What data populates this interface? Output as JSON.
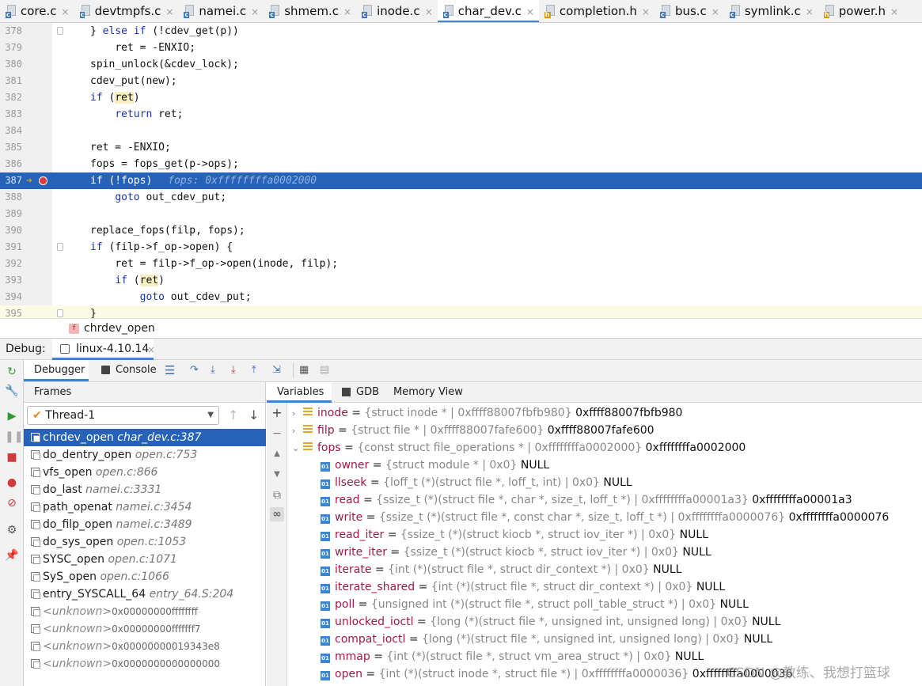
{
  "tabs": [
    {
      "label": "core.c",
      "type": "c"
    },
    {
      "label": "devtmpfs.c",
      "type": "c"
    },
    {
      "label": "namei.c",
      "type": "c"
    },
    {
      "label": "shmem.c",
      "type": "c"
    },
    {
      "label": "inode.c",
      "type": "c"
    },
    {
      "label": "char_dev.c",
      "type": "c",
      "active": true
    },
    {
      "label": "completion.h",
      "type": "h"
    },
    {
      "label": "bus.c",
      "type": "c"
    },
    {
      "label": "symlink.c",
      "type": "c"
    },
    {
      "label": "power.h",
      "type": "h"
    }
  ],
  "editor": {
    "lines": [
      {
        "n": "378",
        "text": "} else if (!cdev_get(p))"
      },
      {
        "n": "379",
        "text": "    ret = -ENXIO;"
      },
      {
        "n": "380",
        "text": "spin_unlock(&cdev_lock);"
      },
      {
        "n": "381",
        "text": "cdev_put(new);"
      },
      {
        "n": "382",
        "text": "if (ret)"
      },
      {
        "n": "383",
        "text": "    return ret;"
      },
      {
        "n": "384",
        "text": ""
      },
      {
        "n": "385",
        "text": "ret = -ENXIO;"
      },
      {
        "n": "386",
        "text": "fops = fops_get(p->ops);"
      },
      {
        "n": "387",
        "text": "if (!fops)",
        "inline": "fops: 0xffffffffa0002000"
      },
      {
        "n": "388",
        "text": "    goto out_cdev_put;"
      },
      {
        "n": "389",
        "text": ""
      },
      {
        "n": "390",
        "text": "replace_fops(filp, fops);"
      },
      {
        "n": "391",
        "text": "if (filp->f_op->open) {"
      },
      {
        "n": "392",
        "text": "    ret = filp->f_op->open(inode, filp);"
      },
      {
        "n": "393",
        "text": "    if (ret)"
      },
      {
        "n": "394",
        "text": "        goto out_cdev_put;"
      },
      {
        "n": "395",
        "text": "}"
      }
    ]
  },
  "breadcrumb": {
    "badge": "f",
    "label": "chrdev_open"
  },
  "debug": {
    "title": "Debug:",
    "session": "linux-4.10.14",
    "tabs": {
      "debugger": "Debugger",
      "console": "Console"
    },
    "frames_label": "Frames",
    "thread": "Thread-1",
    "frames": [
      {
        "fn": "chrdev_open",
        "loc": "char_dev.c:387"
      },
      {
        "fn": "do_dentry_open",
        "loc": "open.c:753"
      },
      {
        "fn": "vfs_open",
        "loc": "open.c:866"
      },
      {
        "fn": "do_last",
        "loc": "namei.c:3331"
      },
      {
        "fn": "path_openat",
        "loc": "namei.c:3454"
      },
      {
        "fn": "do_filp_open",
        "loc": "namei.c:3489"
      },
      {
        "fn": "do_sys_open",
        "loc": "open.c:1053"
      },
      {
        "fn": "SYSC_open",
        "loc": "open.c:1071"
      },
      {
        "fn": "SyS_open",
        "loc": "open.c:1066"
      },
      {
        "fn": "entry_SYSCALL_64",
        "loc": "entry_64.S:204"
      },
      {
        "unknown": "<unknown>",
        "addr": "0x00000000ffffffff"
      },
      {
        "unknown": "<unknown>",
        "addr": "0x00000000fffffff7"
      },
      {
        "unknown": "<unknown>",
        "addr": "0x00000000019343e8"
      },
      {
        "unknown": "<unknown>",
        "addr": "0x0000000000000000"
      }
    ],
    "var_tabs": {
      "variables": "Variables",
      "gdb": "GDB",
      "memory": "Memory View"
    },
    "variables": [
      {
        "name": "inode",
        "type": "{struct inode * | 0xffff88007fbfb980}",
        "value": "0xffff88007fbfb980",
        "kind": "stack",
        "arrow": "›"
      },
      {
        "name": "filp",
        "type": "{struct file * | 0xffff88007fafe600}",
        "value": "0xffff88007fafe600",
        "kind": "stack",
        "arrow": "›"
      },
      {
        "name": "fops",
        "type": "{const struct file_operations * | 0xffffffffa0002000}",
        "value": "0xffffffffa0002000",
        "kind": "stack",
        "arrow": "⌄"
      },
      {
        "name": "owner",
        "type": "{struct module * | 0x0}",
        "value": "NULL",
        "kind": "field"
      },
      {
        "name": "llseek",
        "type": "{loff_t (*)(struct file *, loff_t, int) | 0x0}",
        "value": "NULL",
        "kind": "field"
      },
      {
        "name": "read",
        "type": "{ssize_t (*)(struct file *, char *, size_t, loff_t *) | 0xffffffffa00001a3}",
        "value": "0xffffffffa00001a3",
        "kind": "field"
      },
      {
        "name": "write",
        "type": "{ssize_t (*)(struct file *, const char *, size_t, loff_t *) | 0xffffffffa0000076}",
        "value": "0xffffffffa0000076",
        "kind": "field"
      },
      {
        "name": "read_iter",
        "type": "{ssize_t (*)(struct kiocb *, struct iov_iter *) | 0x0}",
        "value": "NULL",
        "kind": "field"
      },
      {
        "name": "write_iter",
        "type": "{ssize_t (*)(struct kiocb *, struct iov_iter *) | 0x0}",
        "value": "NULL",
        "kind": "field"
      },
      {
        "name": "iterate",
        "type": "{int (*)(struct file *, struct dir_context *) | 0x0}",
        "value": "NULL",
        "kind": "field"
      },
      {
        "name": "iterate_shared",
        "type": "{int (*)(struct file *, struct dir_context *) | 0x0}",
        "value": "NULL",
        "kind": "field"
      },
      {
        "name": "poll",
        "type": "{unsigned int (*)(struct file *, struct poll_table_struct *) | 0x0}",
        "value": "NULL",
        "kind": "field"
      },
      {
        "name": "unlocked_ioctl",
        "type": "{long (*)(struct file *, unsigned int, unsigned long) | 0x0}",
        "value": "NULL",
        "kind": "field"
      },
      {
        "name": "compat_ioctl",
        "type": "{long (*)(struct file *, unsigned int, unsigned long) | 0x0}",
        "value": "NULL",
        "kind": "field"
      },
      {
        "name": "mmap",
        "type": "{int (*)(struct file *, struct vm_area_struct *) | 0x0}",
        "value": "NULL",
        "kind": "field"
      },
      {
        "name": "open",
        "type": "{int (*)(struct inode *, struct file *) | 0xffffffffa0000036}",
        "value": "0xffffffffa0000036",
        "kind": "field"
      }
    ]
  },
  "watermark": "CSDN @教练、我想打篮球",
  "colors": {
    "accent": "#2663b8",
    "keyword": "#1a34ad",
    "var_name": "#a1184a"
  }
}
